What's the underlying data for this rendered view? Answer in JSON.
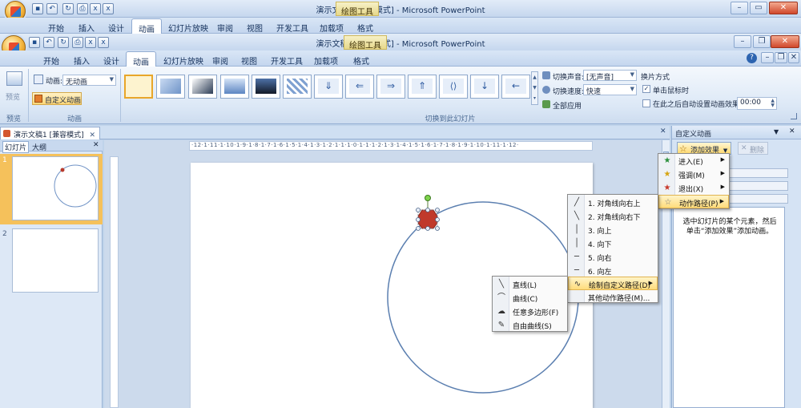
{
  "back_window": {
    "title": "演示文稿1 [兼容模式] - Microsoft PowerPoint",
    "context_tab": "绘图工具",
    "tabs": [
      "开始",
      "插入",
      "设计",
      "动画",
      "幻灯片放映",
      "审阅",
      "视图",
      "开发工具",
      "加载项",
      "格式"
    ],
    "active_tab": "动画"
  },
  "window": {
    "title": "演示文稿1 [兼容模式] - Microsoft PowerPoint",
    "context_tab": "绘图工具"
  },
  "tabs": [
    "开始",
    "插入",
    "设计",
    "动画",
    "幻灯片放映",
    "审阅",
    "视图",
    "开发工具",
    "加载项",
    "格式"
  ],
  "active_tab": "动画",
  "ribbon": {
    "preview_button": "预览",
    "preview_group": "预览",
    "animation_label": "动画:",
    "animation_value": "无动画",
    "custom_animation_button": "自定义动画",
    "animation_group": "动画",
    "transition_group": "切换到此幻灯片",
    "sound_label": "切换声音:",
    "sound_value": "[无声音]",
    "speed_label": "切换速度:",
    "speed_value": "快速",
    "apply_all": "全部应用",
    "advance_header": "换片方式",
    "on_click": "单击鼠标时",
    "after_label": "在此之后自动设置动画效果:",
    "after_value": "00:00"
  },
  "document_tab": "演示文稿1 [兼容模式]",
  "pane_tabs": {
    "slides": "幻灯片",
    "outline": "大纲"
  },
  "slide_numbers": [
    "1",
    "2"
  ],
  "ruler_text": "·12·1·11·1·10·1·9·1·8·1·7·1·6·1·5·1·4·1·3·1·2·1·1·1·0·1·1·1·2·1·3·1·4·1·5·1·6·1·7·1·8·1·9·1·10·1·11·1·12·",
  "task_pane": {
    "title": "自定义动画",
    "add_effect": "添加效果",
    "remove": "删除",
    "description": "选中幻灯片的某个元素，然后单击“添加效果”添加动画。"
  },
  "menu_effects": [
    {
      "label": "进入(E)",
      "icon": "entrance-star-icon"
    },
    {
      "label": "强调(M)",
      "icon": "emphasis-star-icon"
    },
    {
      "label": "退出(X)",
      "icon": "exit-star-icon"
    },
    {
      "label": "动作路径(P)",
      "icon": "motion-path-star-icon"
    }
  ],
  "menu_paths": [
    "1. 对角线向右上",
    "2. 对角线向右下",
    "3. 向上",
    "4. 向下",
    "5. 向右",
    "6. 向左",
    "绘制自定义路径(D)",
    "其他动作路径(M)..."
  ],
  "menu_draw": [
    "直线(L)",
    "曲线(C)",
    "任意多边形(F)",
    "自由曲线(S)"
  ],
  "colors": {
    "accent": "#e8a62a",
    "shape_fill": "#c0392b",
    "circle_stroke": "#5b7fb0",
    "highlight": "#ffdc7c"
  }
}
